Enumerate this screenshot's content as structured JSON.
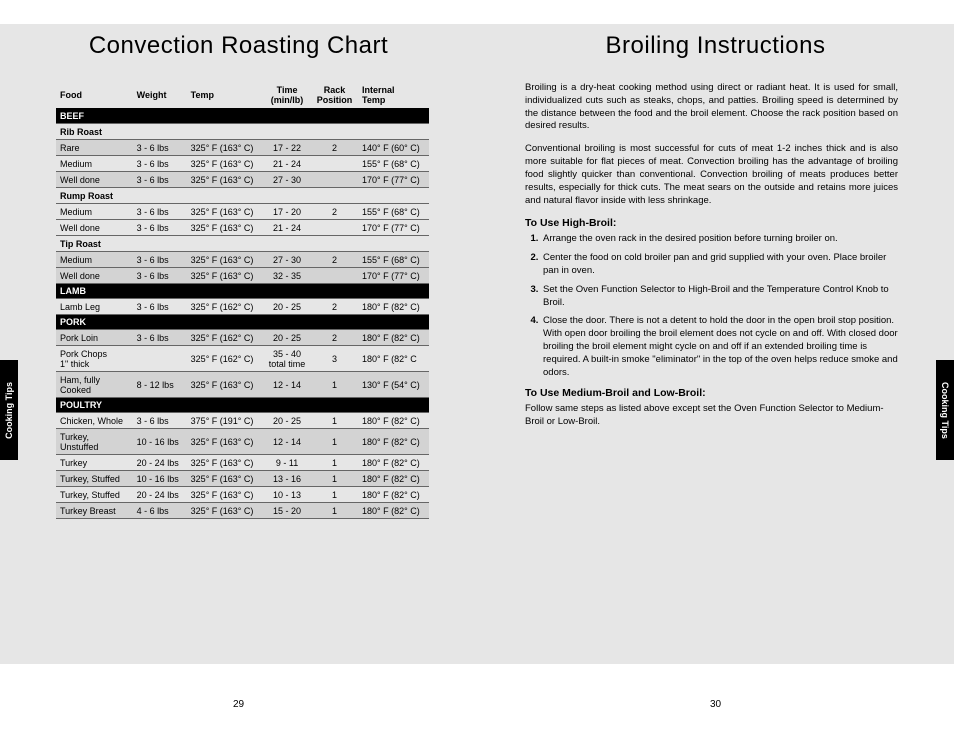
{
  "sideTab": "Cooking Tips",
  "left": {
    "title": "Convection Roasting Chart",
    "pageNum": "29",
    "headers": [
      "Food",
      "Weight",
      "Temp",
      "Time\n(min/lb)",
      "Rack\nPosition",
      "Internal\nTemp"
    ],
    "rows": [
      {
        "type": "section",
        "cells": [
          "BEEF"
        ]
      },
      {
        "type": "subhead",
        "cells": [
          "Rib Roast",
          "",
          "",
          "",
          "",
          ""
        ]
      },
      {
        "type": "alt",
        "cells": [
          "Rare",
          "3 - 6 lbs",
          "325° F (163° C)",
          "17 - 22",
          "2",
          "140° F (60° C)"
        ]
      },
      {
        "type": "norm",
        "cells": [
          "Medium",
          "3 - 6 lbs",
          "325° F (163° C)",
          "21 - 24",
          "",
          "155° F (68° C)"
        ]
      },
      {
        "type": "alt",
        "cells": [
          "Well done",
          "3 - 6 lbs",
          "325° F (163° C)",
          "27 - 30",
          "",
          "170° F (77° C)"
        ]
      },
      {
        "type": "subhead",
        "cells": [
          "Rump Roast",
          "",
          "",
          "",
          "",
          ""
        ]
      },
      {
        "type": "norm",
        "cells": [
          "Medium",
          "3 - 6 lbs",
          "325° F (163° C)",
          "17 - 20",
          "2",
          "155° F (68° C)"
        ]
      },
      {
        "type": "norm",
        "cells": [
          "Well done",
          "3 - 6 lbs",
          "325° F (163° C)",
          "21 - 24",
          "",
          "170° F (77° C)"
        ]
      },
      {
        "type": "subhead",
        "cells": [
          "Tip Roast",
          "",
          "",
          "",
          "",
          ""
        ]
      },
      {
        "type": "alt",
        "cells": [
          "Medium",
          "3 - 6 lbs",
          "325° F (163° C)",
          "27 - 30",
          "2",
          "155° F (68° C)"
        ]
      },
      {
        "type": "alt",
        "cells": [
          "Well done",
          "3 - 6 lbs",
          "325° F (163° C)",
          "32 - 35",
          "",
          "170° F (77° C)"
        ]
      },
      {
        "type": "section",
        "cells": [
          "LAMB"
        ]
      },
      {
        "type": "norm",
        "cells": [
          "Lamb Leg",
          "3 - 6 lbs",
          "325° F (162° C)",
          "20 - 25",
          "2",
          "180° F (82° C)"
        ]
      },
      {
        "type": "section",
        "cells": [
          "PORK"
        ]
      },
      {
        "type": "alt",
        "cells": [
          "Pork Loin",
          "3 - 6 lbs",
          "325° F (162° C)",
          "20 - 25",
          "2",
          "180° F (82° C)"
        ]
      },
      {
        "type": "norm",
        "cells": [
          "Pork Chops\n1\" thick",
          "",
          "325° F (162° C)",
          "35 - 40\ntotal time",
          "3",
          "180° F (82° C"
        ]
      },
      {
        "type": "alt",
        "cells": [
          "Ham, fully\nCooked",
          "8 - 12 lbs",
          "325° F (163° C)",
          "12 - 14",
          "1",
          "130° F (54° C)"
        ]
      },
      {
        "type": "section",
        "cells": [
          "POULTRY"
        ]
      },
      {
        "type": "norm",
        "cells": [
          "Chicken, Whole",
          "3 - 6 lbs",
          "375° F (191° C)",
          "20 - 25",
          "1",
          "180° F (82° C)"
        ]
      },
      {
        "type": "alt",
        "cells": [
          "Turkey,\nUnstuffed",
          "10 - 16 lbs",
          "325° F (163° C)",
          "12 - 14",
          "1",
          "180° F (82° C)"
        ]
      },
      {
        "type": "norm",
        "cells": [
          "Turkey",
          "20 - 24 lbs",
          "325° F (163° C)",
          "9 - 11",
          "1",
          "180° F (82° C)"
        ]
      },
      {
        "type": "alt",
        "cells": [
          "Turkey, Stuffed",
          "10 - 16 lbs",
          "325° F (163° C)",
          "13 - 16",
          "1",
          "180° F (82° C)"
        ]
      },
      {
        "type": "norm",
        "cells": [
          "Turkey, Stuffed",
          "20 - 24 lbs",
          "325° F (163° C)",
          "10 - 13",
          "1",
          "180° F (82° C)"
        ]
      },
      {
        "type": "alt",
        "cells": [
          "Turkey Breast",
          "4 - 6 lbs",
          "325° F (163° C)",
          "15 - 20",
          "1",
          "180° F (82° C)"
        ]
      }
    ]
  },
  "right": {
    "title": "Broiling Instructions",
    "pageNum": "30",
    "para1": "Broiling is a dry-heat cooking method using direct or radiant heat. It is used for small, individualized cuts such as steaks, chops, and patties. Broiling speed is determined by the distance between the food and the broil element. Choose the rack position based on desired results.",
    "para2": "Conventional broiling is most successful for cuts of meat 1-2 inches thick and is also more suitable for flat pieces of meat. Convection broiling has the advantage of broiling food slightly quicker than conventional. Convection broiling of meats produces better results, especially for thick cuts. The meat sears on the outside and retains more juices and natural flavor inside with less shrinkage.",
    "h1": "To Use High-Broil:",
    "steps": [
      "Arrange the oven rack in the desired position before turning broiler on.",
      "Center the food on cold broiler pan and grid supplied with your oven.  Place broiler pan in oven.",
      "Set the Oven Function Selector to High-Broil and the Temperature Control Knob to Broil.",
      "Close the door.  There is not a detent to hold the door in the open broil stop position.  With open door broiling the broil element does not cycle on and off.  With closed door broiling the broil element might cycle on and off if an extended broiling time is required.  A built-in smoke \"eliminator\" in the top of the oven helps reduce smoke and odors."
    ],
    "h2": "To Use Medium-Broil and Low-Broil:",
    "para3": "Follow same steps as listed above except set the Oven Function Selector to Medium-Broil or Low-Broil."
  }
}
